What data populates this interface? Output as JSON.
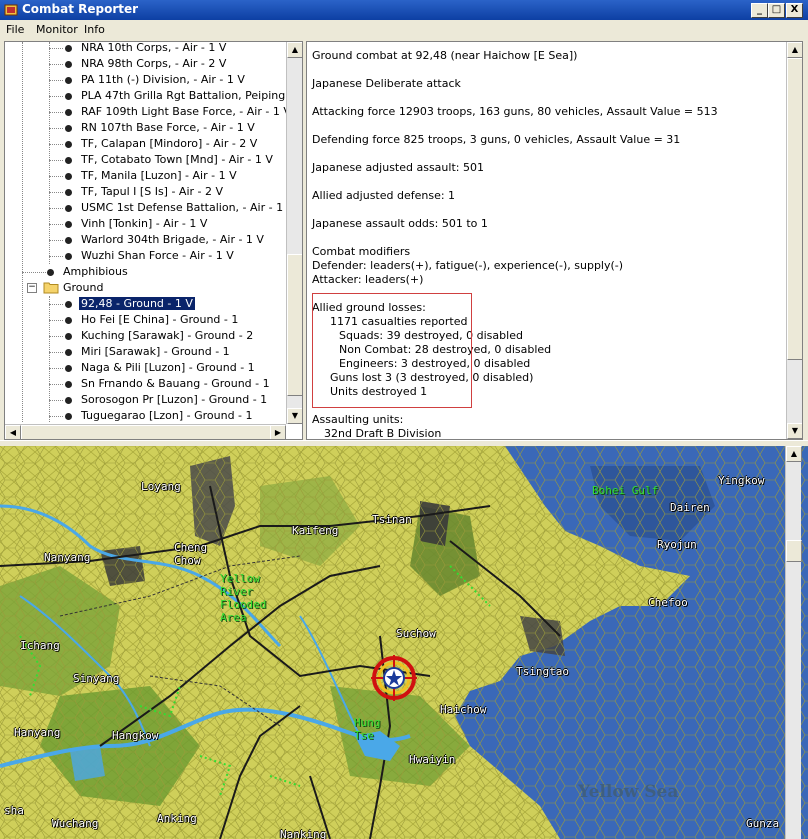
{
  "window": {
    "title": "Combat Reporter",
    "controls": {
      "minimize": "_",
      "maximize": "□",
      "close": "X"
    }
  },
  "menu": [
    "File",
    "Monitor",
    "Info"
  ],
  "tree": {
    "air_units": [
      "NRA 10th Corps,  - Air - 1 V",
      "NRA 98th Corps,  - Air - 2 V",
      "PA 11th (-) Division,  - Air - 1 V",
      "PLA 47th Grilla Rgt Battalion, Peiping [NE C",
      "RAF 109th Light Base Force,  - Air - 1 V",
      "RN 107th Base Force,  - Air - 1 V",
      "TF, Calapan [Mindoro]  - Air - 2 V",
      "TF, Cotabato Town [Mnd]  - Air - 1 V",
      "TF, Manila [Luzon]  - Air - 1 V",
      "TF, Tapul I [S Is]  - Air - 2 V",
      "USMC 1st Defense Battalion,  - Air - 1 V",
      "Vinh [Tonkin]  - Air - 1 V",
      "Warlord 304th Brigade,  - Air - 1 V",
      "Wuzhi Shan Force  - Air - 1 V"
    ],
    "amphibious": "Amphibious",
    "ground_folder": "Ground",
    "ground_units": [
      "92,48 - Ground - 1 V",
      "Ho Fei [E China]  - Ground - 1",
      "Kuching [Sarawak]  - Ground - 2",
      "Miri [Sarawak]  - Ground - 1",
      "Naga & Pili [Luzon]  - Ground - 1",
      "Sn Frnando & Bauang  - Ground - 1",
      "Sorosogon Pr [Luzon]  - Ground - 1",
      "Tuguegarao [Lzon]  - Ground - 1"
    ],
    "selected_index": 0
  },
  "report": {
    "header": "Ground combat at 92,48 (near Haichow [E Sea])",
    "attack_type": "Japanese Deliberate attack",
    "attacking": "Attacking force 12903 troops, 163 guns, 80 vehicles, Assault Value = 513",
    "defending": "Defending force 825 troops, 3 guns, 0 vehicles, Assault Value = 31",
    "adj_assault": "Japanese adjusted assault: 501",
    "adj_defense": "Allied adjusted defense: 1",
    "odds": "Japanese assault odds: 501 to 1",
    "modifiers_title": "Combat modifiers",
    "modifiers_def": "Defender: leaders(+), fatigue(-), experience(-), supply(-)",
    "modifiers_att": "Attacker: leaders(+)",
    "losses_title": "Allied ground losses:",
    "casualties": "1171 casualties reported",
    "squads": "Squads: 39 destroyed, 0 disabled",
    "noncombat": "Non Combat: 28 destroyed, 0 disabled",
    "engineers": "Engineers: 3 destroyed, 0 disabled",
    "guns": "Guns lost 3 (3 destroyed, 0 disabled)",
    "units_destroyed": "Units destroyed 1",
    "assaulting_title": "Assaulting units:",
    "assaulting_first": "32nd Draft B Division"
  },
  "map": {
    "cities": {
      "loyang": "Loyang",
      "cheng_chow": "Cheng\nChow",
      "kaifeng": "Kaifeng",
      "tsinan": "Tsinan",
      "nanyang": "Nanyang",
      "ichang": "Ichang",
      "sinyang": "Sinyang",
      "suchow": "Suchow",
      "tsingtao": "Tsingtao",
      "haichow": "Haichow",
      "hanyang": "Hanyang",
      "hangkow": "Hangkow",
      "hwaiyin": "Hwaiyin",
      "wuchang": "Wuchang",
      "anking": "Anking",
      "nanking": "Nanking",
      "chefoo": "Chefoo",
      "ryojun": "Ryojun",
      "dairen": "Dairen",
      "yingkow": "Yingkow",
      "gunza": "Gunza",
      "sha": "sha",
      "hung_tse": "Hung\nTse"
    },
    "regions": {
      "bohei_gulf": "Bohei Gulf",
      "yellow_river": "Yellow\nRiver\nFlooded\nArea",
      "yellow_sea": "Yellow Sea"
    },
    "colors": {
      "sea": "#3a68b8",
      "land": "#c8c85a",
      "forest": "#6a9a30",
      "road": "#1a1a1a",
      "accent": "#2b63c8"
    }
  }
}
